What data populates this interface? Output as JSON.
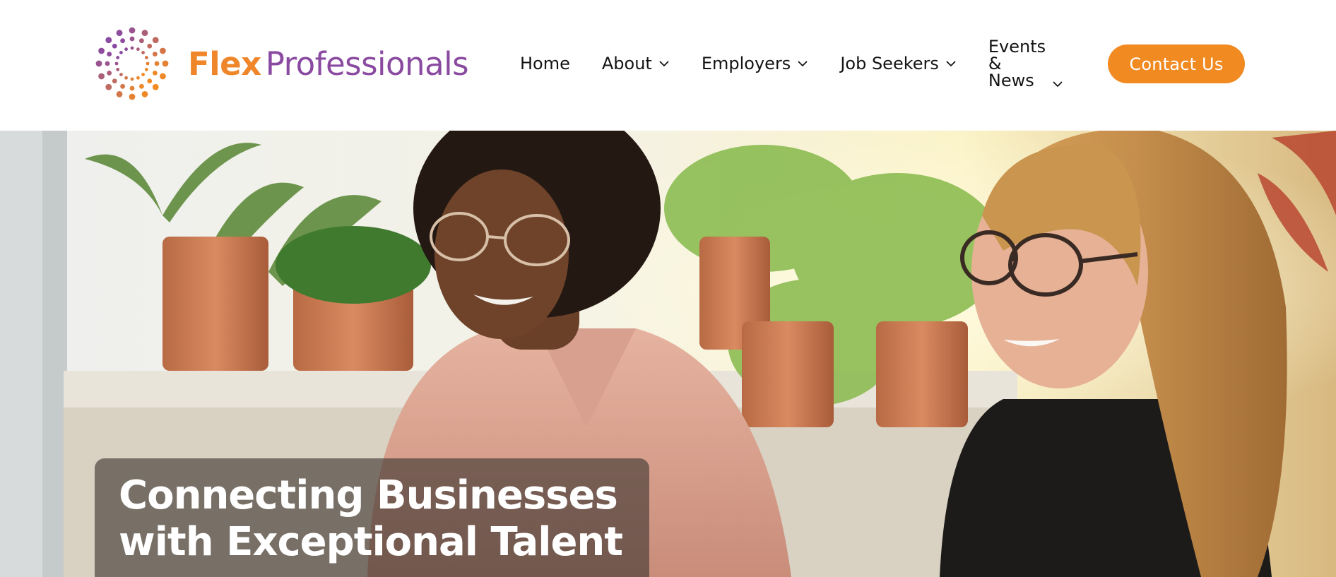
{
  "brand": {
    "name_part1": "Flex",
    "name_part2": "Professionals",
    "accent_orange": "#f28a22",
    "accent_purple": "#8a4aa0"
  },
  "nav": {
    "home": "Home",
    "about": "About",
    "employers": "Employers",
    "job_seekers": "Job Seekers",
    "events_line1": "Events",
    "events_line2": "&",
    "events_line3": "News"
  },
  "cta": {
    "contact_label": "Contact Us"
  },
  "hero": {
    "title_line1": "Connecting Businesses",
    "title_line2": "with Exceptional Talent"
  }
}
